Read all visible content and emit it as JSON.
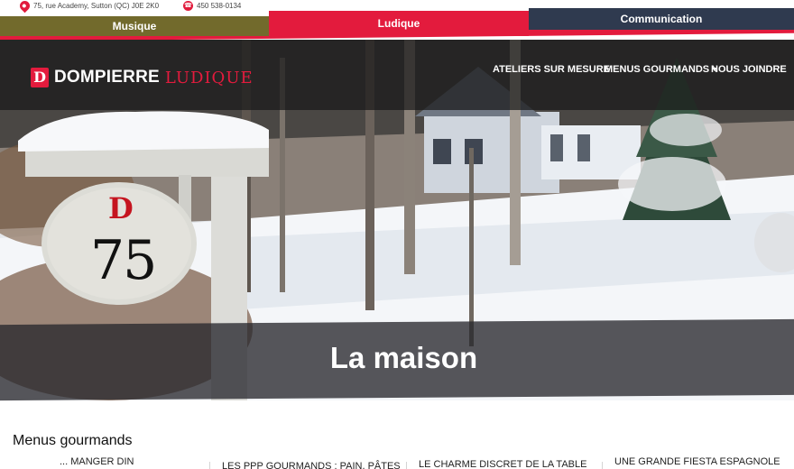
{
  "info": {
    "address": "75, rue Academy, Sutton (QC) J0E 2K0",
    "phone": "450 538-0134"
  },
  "tabs": {
    "musique": "Musique",
    "ludique": "Ludique",
    "communication": "Communication"
  },
  "logo": {
    "mark": "D",
    "primary": "DOMPIERRE",
    "secondary": "LUDIQUE"
  },
  "nav": {
    "ateliers": "ATELIERS SUR MESURE",
    "menus": "MENUS GOURMANDS",
    "joindre": "NOUS JOINDRE"
  },
  "sign": {
    "letter": "D",
    "number": "75"
  },
  "hero": {
    "title": "La maison"
  },
  "content": {
    "section_title": "Menus gourmands",
    "cards": [
      "... MANGER DIN",
      "LES PPP GOURMANDS : PAIN, PÂTES",
      "LE CHARME DISCRET DE LA TABLE",
      "UNE GRANDE FIESTA ESPAGNOLE"
    ]
  },
  "colors": {
    "brand_red": "#e31b3d",
    "musique_olive": "#726a2c",
    "communication_navy": "#2f3a4f"
  }
}
